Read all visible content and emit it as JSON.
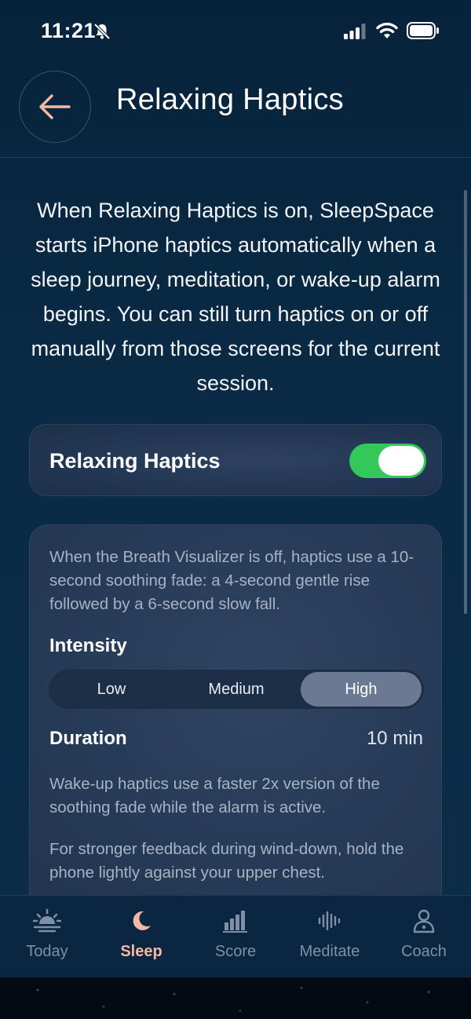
{
  "status_bar": {
    "time": "11:21",
    "icons": [
      "bell-slash-icon",
      "cellular-signal-icon",
      "wifi-icon",
      "battery-icon"
    ]
  },
  "header": {
    "title": "Relaxing Haptics",
    "back_icon": "arrow-left-icon"
  },
  "intro_text": "When Relaxing Haptics is on, SleepSpace starts iPhone haptics automatically when a sleep journey, meditation, or wake-up alarm begins. You can still turn haptics on or off manually from those screens for the current session.",
  "toggle": {
    "label": "Relaxing Haptics",
    "enabled": true
  },
  "settings": {
    "breath_note": "When the Breath Visualizer is off, haptics use a 10-second soothing fade: a 4-second gentle rise followed by a 6-second slow fall.",
    "intensity_label": "Intensity",
    "intensity_options": [
      "Low",
      "Medium",
      "High"
    ],
    "intensity_selected": "High",
    "duration_label": "Duration",
    "duration_value": "10 min",
    "wake_note": "Wake-up haptics use a faster 2x version of the soothing fade while the alarm is active.",
    "chest_note": "For stronger feedback during wind-down, hold the phone lightly against your upper chest."
  },
  "tab_bar": {
    "items": [
      {
        "label": "Today",
        "icon": "sunrise-icon"
      },
      {
        "label": "Sleep",
        "icon": "moon-icon"
      },
      {
        "label": "Score",
        "icon": "bar-chart-icon"
      },
      {
        "label": "Meditate",
        "icon": "waveform-icon"
      },
      {
        "label": "Coach",
        "icon": "coach-icon"
      }
    ],
    "active": "Sleep"
  },
  "colors": {
    "background": "#08253d",
    "accent": "#f4b8a7",
    "toggle_on": "#34c759",
    "inactive_tab": "#7f90a6"
  }
}
